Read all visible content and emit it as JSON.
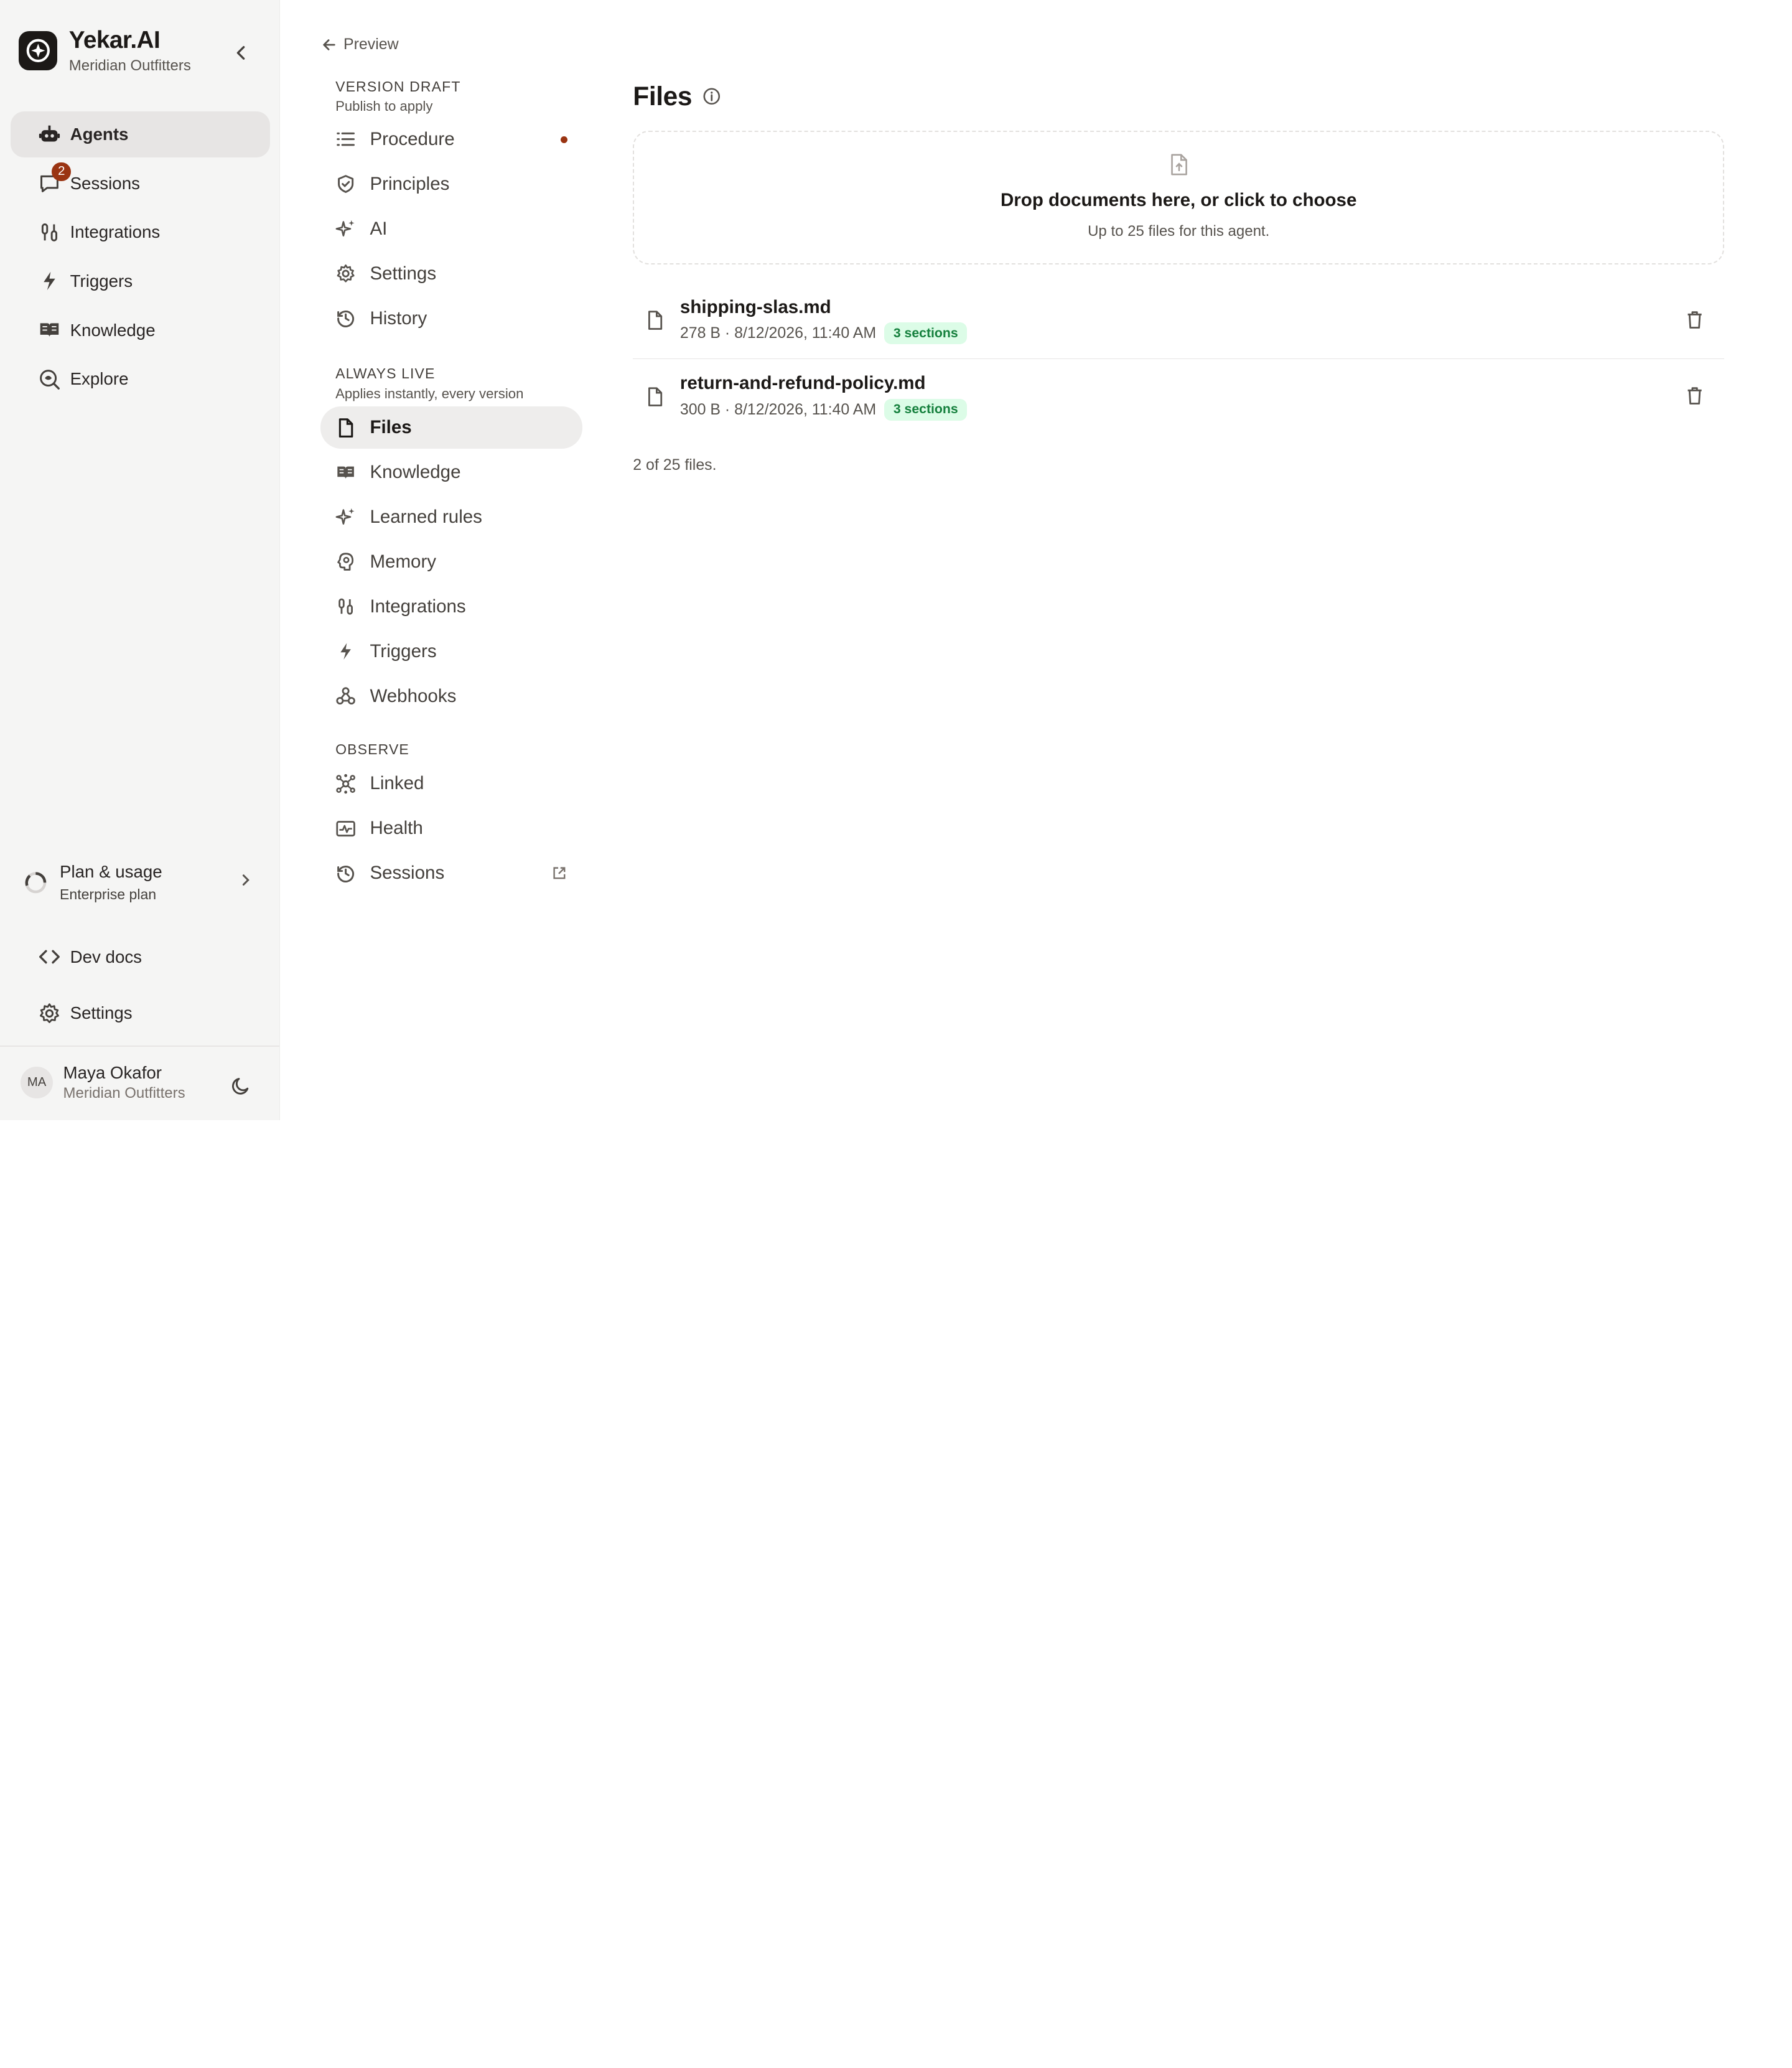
{
  "brand": {
    "name": "Yekar.AI",
    "org": "Meridian Outfitters"
  },
  "sidebar": {
    "items": [
      {
        "label": "Agents",
        "icon": "bot-icon",
        "active": true
      },
      {
        "label": "Sessions",
        "icon": "chat-icon",
        "badge": "2"
      },
      {
        "label": "Integrations",
        "icon": "integrations-icon"
      },
      {
        "label": "Triggers",
        "icon": "bolt-icon"
      },
      {
        "label": "Knowledge",
        "icon": "book-icon"
      },
      {
        "label": "Explore",
        "icon": "explore-icon"
      }
    ],
    "plan": {
      "title": "Plan & usage",
      "subtitle": "Enterprise plan"
    },
    "dev_docs": "Dev docs",
    "settings": "Settings",
    "user": {
      "initials": "MA",
      "name": "Maya Okafor",
      "org": "Meridian Outfitters"
    }
  },
  "subnav": {
    "back_label": "Preview",
    "version_draft": {
      "title": "VERSION DRAFT",
      "subtitle": "Publish to apply",
      "items": [
        "Procedure",
        "Principles",
        "AI",
        "Settings",
        "History"
      ]
    },
    "always_live": {
      "title": "ALWAYS LIVE",
      "subtitle": "Applies instantly, every version",
      "items": [
        "Files",
        "Knowledge",
        "Learned rules",
        "Memory",
        "Integrations",
        "Triggers",
        "Webhooks"
      ]
    },
    "observe": {
      "title": "OBSERVE",
      "items": [
        "Linked",
        "Health",
        "Sessions"
      ]
    }
  },
  "main": {
    "title": "Files",
    "dropzone": {
      "title": "Drop documents here, or click to choose",
      "subtitle": "Up to 25 files for this agent."
    },
    "files": [
      {
        "name": "shipping-slas.md",
        "meta": "278 B · 8/12/2026, 11:40 AM",
        "sections": "3 sections"
      },
      {
        "name": "return-and-refund-policy.md",
        "meta": "300 B · 8/12/2026, 11:40 AM",
        "sections": "3 sections"
      }
    ],
    "count": "2 of 25 files."
  },
  "colors": {
    "accent_dot": "#9a3412",
    "badge_green_bg": "#dcfce7",
    "badge_green_text": "#15803d"
  }
}
